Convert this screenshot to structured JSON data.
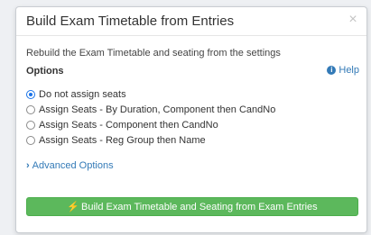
{
  "dialog": {
    "title": "Build Exam Timetable from Entries",
    "close_glyph": "×"
  },
  "body": {
    "description": "Rebuild the Exam Timetable and seating from the settings",
    "options_heading": "Options",
    "help_label": "Help",
    "help_icon": "info-circle-icon",
    "radio_options": [
      {
        "label": "Do not assign seats",
        "checked": true
      },
      {
        "label": "Assign Seats - By Duration, Component then CandNo",
        "checked": false
      },
      {
        "label": "Assign Seats - Component then CandNo",
        "checked": false
      },
      {
        "label": "Assign Seats - Reg Group then Name",
        "checked": false
      }
    ],
    "advanced_label": "Advanced Options"
  },
  "action": {
    "build_label": "Build Exam Timetable and Seating from Exam Entries",
    "build_icon": "bolt-icon"
  },
  "colors": {
    "link": "#337ab7",
    "primary_button": "#5cb85c",
    "radio_checked": "#1a73e8"
  }
}
